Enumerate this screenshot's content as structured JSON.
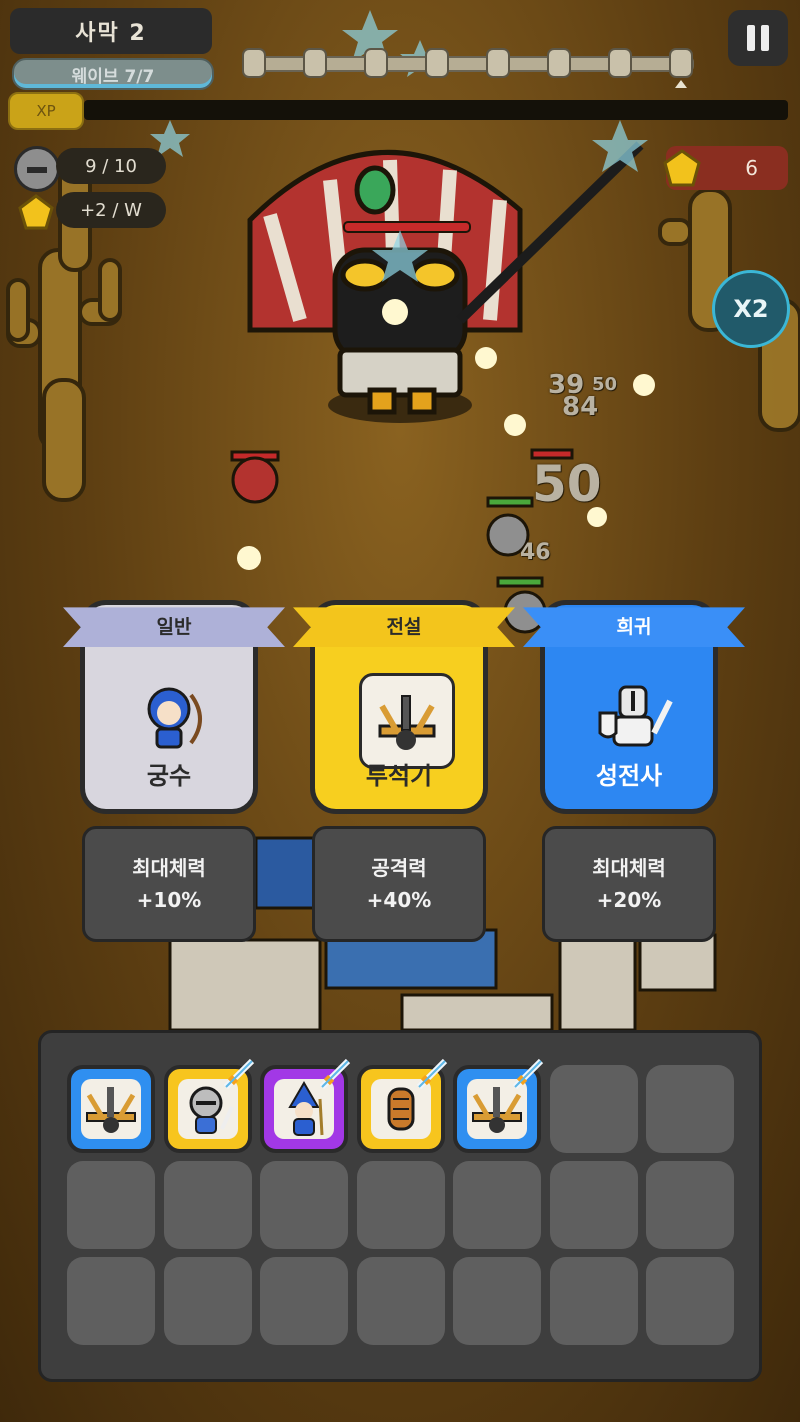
{
  "hud": {
    "stage_title": "사막 2",
    "wave_label": "웨이브 7/7",
    "xp_label": "XP",
    "unit_count": "9 / 10",
    "income": "+2 / W",
    "gem_count": "6",
    "speed_label": "X2"
  },
  "battle": {
    "damage_numbers": [
      "39",
      "50",
      "84",
      "50",
      "46"
    ]
  },
  "cards": [
    {
      "rarity": "일반",
      "name": "궁수",
      "stat_label": "최대체력",
      "stat_value": "+10%",
      "bg": "#d8d6de",
      "ribbon": "#aeb1d8",
      "text_color": "#2b2b2b"
    },
    {
      "rarity": "전설",
      "name": "투석기",
      "stat_label": "공격력",
      "stat_value": "+40%",
      "bg": "#f7cf1f",
      "ribbon": "#f3c51c",
      "text_color": "#2b2b2b"
    },
    {
      "rarity": "희귀",
      "name": "성전사",
      "stat_label": "최대체력",
      "stat_value": "+20%",
      "bg": "#2d87f2",
      "ribbon": "#3a8ff7",
      "text_color": "#ffffff"
    }
  ],
  "inventory": {
    "rows": 3,
    "cols": 7,
    "items": [
      {
        "unit": "catapult-icon",
        "color": "#2f8ff0",
        "upgrade": false
      },
      {
        "unit": "knight-icon",
        "color": "#f7c51e",
        "upgrade": true
      },
      {
        "unit": "wizard-icon",
        "color": "#a238e6",
        "upgrade": true
      },
      {
        "unit": "siege-ram-icon",
        "color": "#f7c51e",
        "upgrade": true
      },
      {
        "unit": "catapult-icon",
        "color": "#2f8ff0",
        "upgrade": true
      }
    ]
  }
}
